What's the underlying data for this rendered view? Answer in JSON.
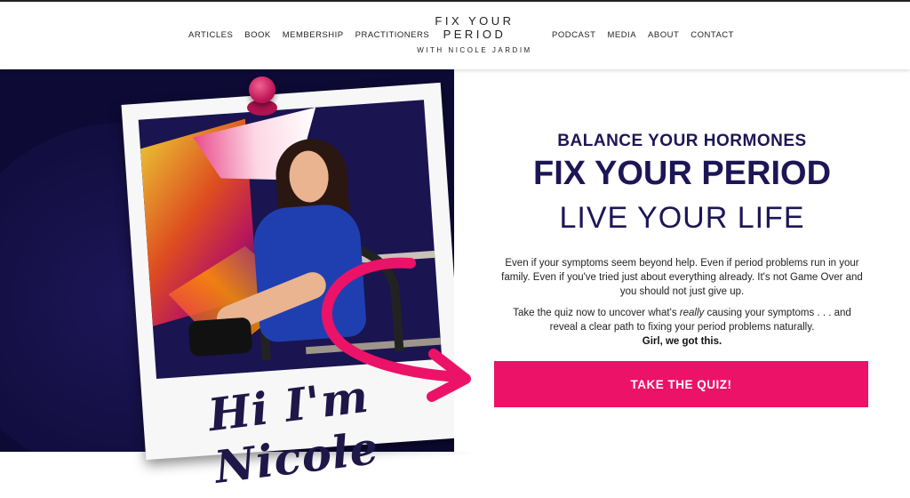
{
  "nav": {
    "left": [
      "ARTICLES",
      "BOOK",
      "MEMBERSHIP",
      "PRACTITIONERS"
    ],
    "right": [
      "PODCAST",
      "MEDIA",
      "ABOUT",
      "CONTACT"
    ]
  },
  "logo": {
    "line1": "FIX YOUR",
    "line2": "PERIOD",
    "tagline": "WITH NICOLE JARDIM"
  },
  "hero_image": {
    "handwriting": "Hi I'm Nicole"
  },
  "hero": {
    "subheading": "BALANCE YOUR HORMONES",
    "heading": "FIX YOUR PERIOD",
    "heading_secondary": "LIVE YOUR LIFE",
    "para1": "Even if  your symptoms seem beyond help. Even if period problems run in your family. Even if you've tried just about everything already. It's not Game Over and you should not just give up.",
    "para2_before": "Take the quiz now to uncover what's ",
    "para2_em": "really",
    "para2_after": " causing your symptoms . . . and reveal a clear path to fixing your period problems naturally.",
    "para3": "Girl, we got this.",
    "cta_label": "TAKE THE QUIZ!"
  },
  "colors": {
    "navy": "#1c1656",
    "dark_bg": "#0d0a35",
    "cta_pink": "#ec1268"
  }
}
